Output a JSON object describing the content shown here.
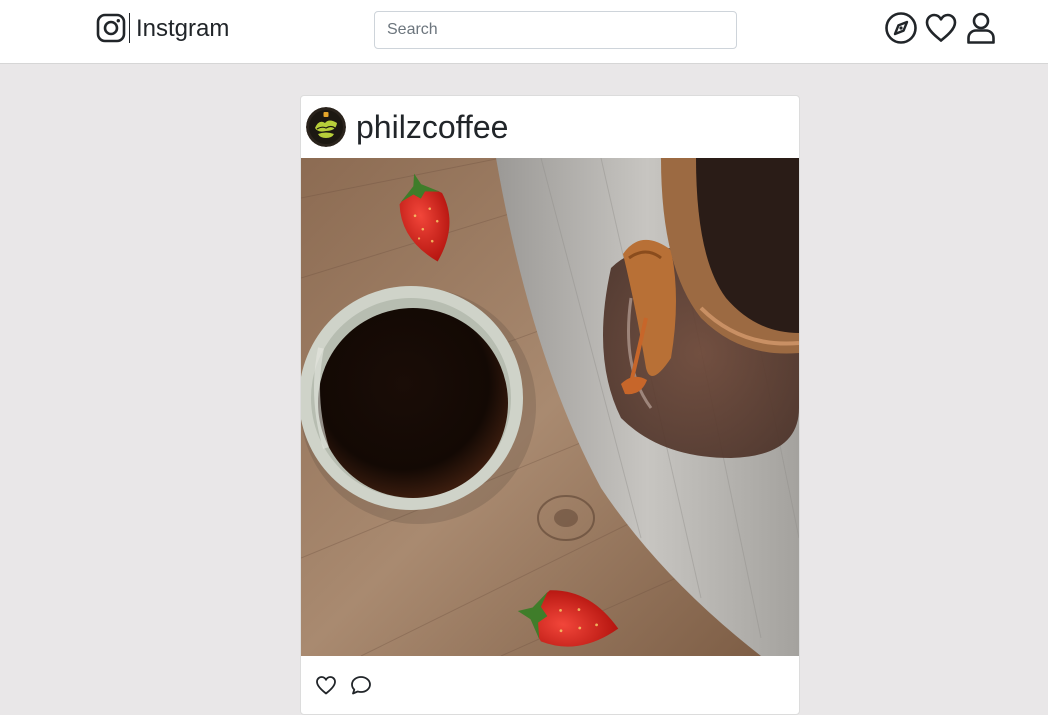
{
  "navbar": {
    "brand_name": "Instgram",
    "brand_icon": "instagram-logo-icon",
    "search": {
      "placeholder": "Search",
      "value": ""
    },
    "icons": [
      "compass-icon",
      "heart-icon",
      "user-icon"
    ]
  },
  "post": {
    "username": "philzcoffee",
    "avatar_icon": "philz-coffee-logo",
    "actions": [
      "like-heart-icon",
      "comment-icon"
    ]
  },
  "colors": {
    "page_background": "#e9e7e8",
    "navbar_background": "#ffffff",
    "text": "#212529"
  }
}
